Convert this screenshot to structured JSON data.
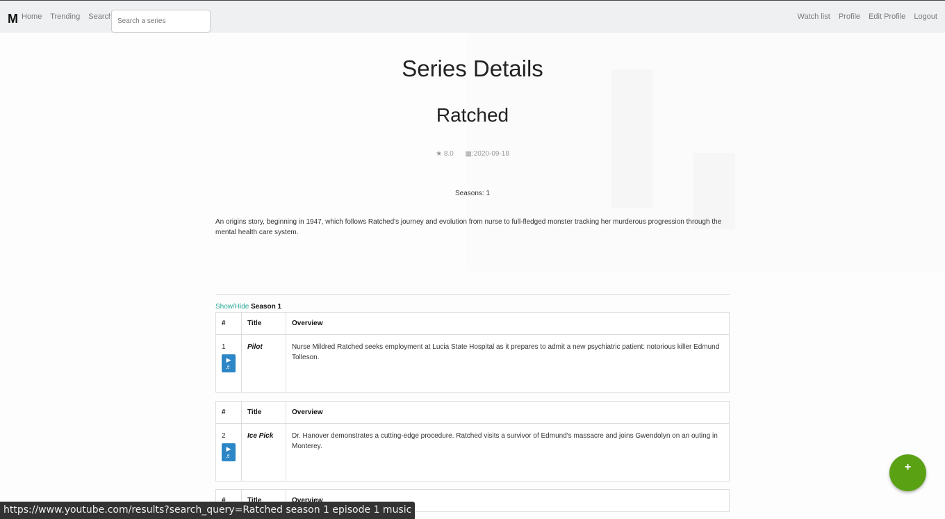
{
  "nav": {
    "logo": "M",
    "links_left": [
      "Home",
      "Trending",
      "Search"
    ],
    "search_placeholder": "Search a series",
    "links_right": [
      "Watch list",
      "Profile",
      "Edit Profile",
      "Logout"
    ]
  },
  "page": {
    "title": "Series Details",
    "series_name": "Ratched",
    "rating": "8.0",
    "date": ":2020-09-18",
    "seasons": "Seasons: 1",
    "overview": "An origins story, beginning in 1947, which follows Ratched's journey and evolution from nurse to full-fledged monster tracking her murderous progression through the mental health care system."
  },
  "season": {
    "toggle_label": "Show/Hide",
    "name": "Season 1"
  },
  "table_headers": {
    "num": "#",
    "title": "Title",
    "overview": "Overview"
  },
  "episodes": [
    {
      "num": "1",
      "title": "Pilot",
      "overview": "Nurse Mildred Ratched seeks employment at Lucia State Hospital as it prepares to admit a new psychiatric patient: notorious killer Edmund Tolleson."
    },
    {
      "num": "2",
      "title": "Ice Pick",
      "overview": "Dr. Hanover demonstrates a cutting-edge procedure. Ratched visits a survivor of Edmund's massacre and joins Gwendolyn on an outing in Monterey."
    }
  ],
  "fab": {
    "label": "+"
  },
  "status_bar": {
    "url": "https://www.youtube.com/results?search_query=Ratched season 1 episode 1 music"
  },
  "colors": {
    "accent_link": "#28a895",
    "music_button": "#2d86c6",
    "fab": "#5aa114"
  }
}
